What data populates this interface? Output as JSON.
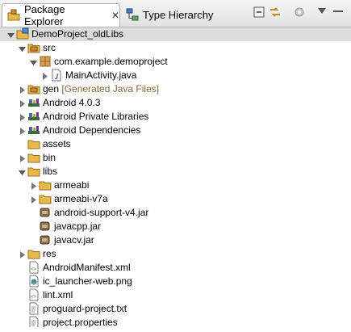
{
  "tabs": [
    {
      "label": "Package Explorer",
      "close": "✕",
      "icon": "package-explorer-icon"
    },
    {
      "label": "Type Hierarchy",
      "icon": "type-hierarchy-icon"
    }
  ],
  "toolbar": [
    "collapse-all-icon",
    "link-with-editor-icon",
    "focus-icon",
    "view-menu-icon"
  ],
  "tree": [
    {
      "label": "DemoProject_oldLibs",
      "icon": "project-icon",
      "expanded": true
    },
    {
      "label": "src",
      "icon": "source-folder-icon",
      "expanded": true
    },
    {
      "label": "com.example.demoproject",
      "icon": "package-icon",
      "expanded": true
    },
    {
      "label": "MainActivity.java",
      "icon": "java-file-icon",
      "expanded": false
    },
    {
      "label": "gen",
      "decoration": "[Generated Java Files]",
      "icon": "source-folder-icon",
      "expanded": false
    },
    {
      "label": "Android 4.0.3",
      "icon": "library-icon",
      "expanded": false
    },
    {
      "label": "Android Private Libraries",
      "icon": "library-icon",
      "expanded": false
    },
    {
      "label": "Android Dependencies",
      "icon": "library-icon",
      "expanded": false
    },
    {
      "label": "assets",
      "icon": "folder-icon"
    },
    {
      "label": "bin",
      "icon": "folder-icon",
      "expanded": false
    },
    {
      "label": "libs",
      "icon": "folder-icon",
      "expanded": true
    },
    {
      "label": "armeabi",
      "icon": "folder-icon",
      "expanded": false
    },
    {
      "label": "armeabi-v7a",
      "icon": "folder-icon",
      "expanded": false
    },
    {
      "label": "android-support-v4.jar",
      "icon": "jar-icon"
    },
    {
      "label": "javacpp.jar",
      "icon": "jar-icon"
    },
    {
      "label": "javacv.jar",
      "icon": "jar-icon"
    },
    {
      "label": "res",
      "icon": "folder-icon",
      "expanded": false
    },
    {
      "label": "AndroidManifest.xml",
      "icon": "xml-file-icon"
    },
    {
      "label": "ic_launcher-web.png",
      "icon": "image-file-icon"
    },
    {
      "label": "lint.xml",
      "icon": "xml-file-icon"
    },
    {
      "label": "proguard-project.txt",
      "icon": "text-file-icon"
    },
    {
      "label": "project.properties",
      "icon": "text-file-icon"
    }
  ],
  "colors": {
    "folder": "#e8b84a",
    "package": "#c8883a",
    "selection": "#dcdcdc",
    "library": "#3a6a3a"
  }
}
